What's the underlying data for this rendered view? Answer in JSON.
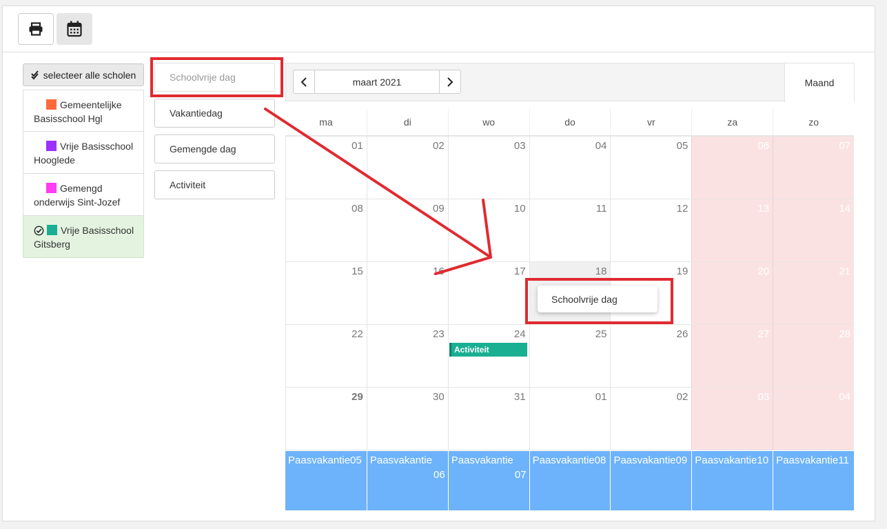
{
  "toolbar": {
    "print_icon": "printer-icon",
    "calendar_icon": "calendar-icon"
  },
  "sidebar": {
    "select_all_label": "selecteer alle scholen",
    "schools": [
      {
        "line1": "Gemeentelijke",
        "line2": "Basisschool Hgl",
        "color": "#ff6a3d",
        "active": false
      },
      {
        "line1": "Vrije Basisschool",
        "line2": "Hooglede",
        "color": "#9b30ff",
        "active": false
      },
      {
        "line1": "Gemengd",
        "line2": "onderwijs Sint-Jozef",
        "color": "#ff3cf0",
        "active": false
      },
      {
        "line1": "Vrije Basisschool",
        "line2": "Gitsberg",
        "color": "#1aaf93",
        "active": true
      }
    ]
  },
  "types": [
    "Schoolvrije dag",
    "Vakantiedag",
    "Gemengde dag",
    "Activiteit"
  ],
  "calendar": {
    "month": "maart 2021",
    "view": "Maand",
    "weekdays": [
      "ma",
      "di",
      "wo",
      "do",
      "vr",
      "za",
      "zo"
    ],
    "weeks": [
      [
        "01",
        "02",
        "03",
        "04",
        "05",
        "06",
        "07"
      ],
      [
        "08",
        "09",
        "10",
        "11",
        "12",
        "13",
        "14"
      ],
      [
        "15",
        "16",
        "17",
        "18",
        "19",
        "20",
        "21"
      ],
      [
        "22",
        "23",
        "24",
        "25",
        "26",
        "27",
        "28"
      ],
      [
        "29",
        "30",
        "31",
        "01",
        "02",
        "03",
        "04"
      ]
    ],
    "event_label": "Activiteit",
    "vacation": [
      {
        "l1": "Paasvakantie05",
        "l2": ""
      },
      {
        "l1": "Paasvakantie",
        "l2": "06"
      },
      {
        "l1": "Paasvakantie",
        "l2": "07"
      },
      {
        "l1": "Paasvakantie08",
        "l2": ""
      },
      {
        "l1": "Paasvakantie09",
        "l2": ""
      },
      {
        "l1": "Paasvakantie10",
        "l2": ""
      },
      {
        "l1": "Paasvakantie11",
        "l2": ""
      }
    ],
    "popup_label": "Schoolvrije dag"
  },
  "colors": {
    "weekend": "#fbe2e2",
    "vacation": "#6db3fb",
    "event": "#1aaf93",
    "annotation": "#e02a30"
  }
}
